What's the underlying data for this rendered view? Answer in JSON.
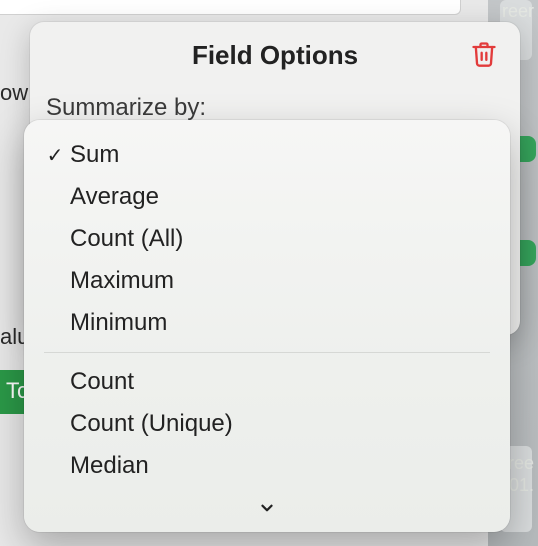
{
  "background": {
    "row_label": "ow",
    "alu_label": "alu",
    "green_btn": "Tc",
    "right_text_top": "reer",
    "right_text_line1": "ree",
    "right_text_line2": "01."
  },
  "popover": {
    "title": "Field Options",
    "summarize_label": "Summarize by:"
  },
  "dropdown": {
    "selected_index": 0,
    "group1": [
      {
        "label": "Sum"
      },
      {
        "label": "Average"
      },
      {
        "label": "Count (All)"
      },
      {
        "label": "Maximum"
      },
      {
        "label": "Minimum"
      }
    ],
    "group2": [
      {
        "label": "Count"
      },
      {
        "label": "Count (Unique)"
      },
      {
        "label": "Median"
      }
    ]
  },
  "icons": {
    "check": "✓"
  }
}
